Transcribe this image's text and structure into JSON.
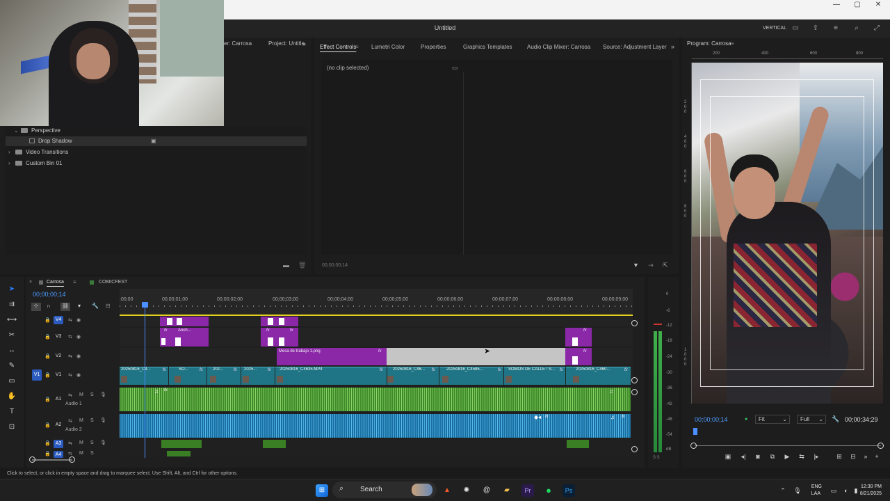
{
  "window": {
    "title": "Untitled",
    "workspace": "VERTICAL",
    "min": "—",
    "max": "▢",
    "close": "✕"
  },
  "project_panel": {
    "tabs": [
      "er: Carrosa",
      "Project: Untitle"
    ],
    "tree": [
      {
        "label": "Perspective",
        "kind": "folder",
        "caret": "⌄"
      },
      {
        "label": "Drop Shadow",
        "kind": "effect",
        "caret": ""
      },
      {
        "label": "Video Transitions",
        "kind": "folder",
        "caret": "›"
      },
      {
        "label": "Custom Bin 01",
        "kind": "folder",
        "caret": "›"
      }
    ]
  },
  "effect_controls": {
    "tabs": [
      "Effect Controls",
      "Lumetri Color",
      "Properties",
      "Graphics Templates",
      "Audio Clip Mixer: Carrosa",
      "Source: Adjustment Layer"
    ],
    "active_tab": "Effect Controls",
    "empty_text": "(no clip selected)",
    "timecode": "00;00;00;14"
  },
  "program_monitor": {
    "title": "Program: Carrosa",
    "ruler_top": [
      "200",
      "400",
      "600",
      "800"
    ],
    "ruler_left": [
      "2",
      "0",
      "0",
      "4",
      "0",
      "0",
      "6",
      "0",
      "0",
      "8",
      "0",
      "0",
      "1",
      "0",
      "0",
      "0"
    ],
    "timecode": "00;00;00;14",
    "fit": "Fit",
    "resolution": "Full",
    "duration": "00;00;34;29"
  },
  "timeline": {
    "tabs": [
      "Carrosa",
      "COMICFEST"
    ],
    "timecode": "00;00;00;14",
    "ruler_ticks": [
      ":00;00",
      "00;00;01;00",
      "00;00;02;00",
      "00;00;03;00",
      "00;00;04;00",
      "00;00;05;00",
      "00;00;06;00",
      "00;00;07;00",
      "00;00;08;00",
      "00;00;09;00"
    ],
    "tracks": {
      "v4": "V4",
      "v3": "V3",
      "v2": "V2",
      "v1": "V1",
      "v1src": "V1",
      "a1": "A1",
      "a1name": "Audio 1",
      "a2": "A2",
      "a2name": "Audio 2",
      "a3": "A3",
      "a4": "A4"
    },
    "clips": {
      "v3_anch": "Anch...",
      "v2_mesa": "Mesa de trabajo 1.png",
      "v1": [
        "20250816_C4...",
        "SO...",
        "202...",
        "2025...",
        "20250816_C4635.MP4",
        "20250816_C46...",
        "20250816_C4585...",
        "SOMOS DE CALLE ! S...",
        "20250816_C460..."
      ]
    },
    "meter_labels": [
      "0",
      "-6",
      "-12",
      "-18",
      "-24",
      "-30",
      "-36",
      "-42",
      "-48",
      "-54",
      "dB"
    ],
    "meter_s": "S S"
  },
  "status_bar": "Click to select, or click in empty space and drag to marquee select. Use Shift, Alt, and Ctrl for other options.",
  "taskbar": {
    "search": "Search",
    "lang": "ENG",
    "lang2": "LAA",
    "time": "12:30 PM",
    "date": "8/21/2025"
  }
}
